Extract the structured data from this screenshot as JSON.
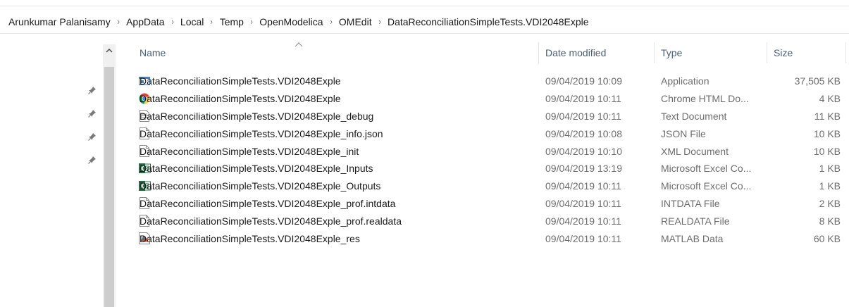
{
  "breadcrumb": [
    "Arunkumar Palanisamy",
    "AppData",
    "Local",
    "Temp",
    "OpenModelica",
    "OMEdit",
    "DataReconciliationSimpleTests.VDI2048Exple"
  ],
  "columns": {
    "name": "Name",
    "date": "Date modified",
    "type": "Type",
    "size": "Size"
  },
  "files": [
    {
      "icon": "application-icon",
      "name": "DataReconciliationSimpleTests.VDI2048Exple",
      "date": "09/04/2019 10:09",
      "type": "Application",
      "size": "37,505 KB"
    },
    {
      "icon": "chrome-icon",
      "name": "DataReconciliationSimpleTests.VDI2048Exple",
      "date": "09/04/2019 10:11",
      "type": "Chrome HTML Do...",
      "size": "4 KB"
    },
    {
      "icon": "text-document-icon",
      "name": "DataReconciliationSimpleTests.VDI2048Exple_debug",
      "date": "09/04/2019 10:11",
      "type": "Text Document",
      "size": "11 KB"
    },
    {
      "icon": "blank-file-icon",
      "name": "DataReconciliationSimpleTests.VDI2048Exple_info.json",
      "date": "09/04/2019 10:08",
      "type": "JSON File",
      "size": "10 KB"
    },
    {
      "icon": "blank-file-icon",
      "name": "DataReconciliationSimpleTests.VDI2048Exple_init",
      "date": "09/04/2019 10:10",
      "type": "XML Document",
      "size": "10 KB"
    },
    {
      "icon": "excel-icon",
      "name": "DataReconciliationSimpleTests.VDI2048Exple_Inputs",
      "date": "09/04/2019 13:19",
      "type": "Microsoft Excel Co...",
      "size": "1 KB"
    },
    {
      "icon": "excel-icon",
      "name": "DataReconciliationSimpleTests.VDI2048Exple_Outputs",
      "date": "09/04/2019 10:11",
      "type": "Microsoft Excel Co...",
      "size": "1 KB"
    },
    {
      "icon": "blank-file-icon",
      "name": "DataReconciliationSimpleTests.VDI2048Exple_prof.intdata",
      "date": "09/04/2019 10:11",
      "type": "INTDATA File",
      "size": "2 KB"
    },
    {
      "icon": "blank-file-icon",
      "name": "DataReconciliationSimpleTests.VDI2048Exple_prof.realdata",
      "date": "09/04/2019 10:11",
      "type": "REALDATA File",
      "size": "8 KB"
    },
    {
      "icon": "matlab-data-icon",
      "name": "DataReconciliationSimpleTests.VDI2048Exple_res",
      "date": "09/04/2019 10:11",
      "type": "MATLAB Data",
      "size": "60 KB"
    }
  ],
  "colors": {
    "header_text": "#4c607a",
    "secondary_text": "#6d6d6d",
    "excel_green": "#1d6f42",
    "scroll_track": "#f0f0f0"
  }
}
